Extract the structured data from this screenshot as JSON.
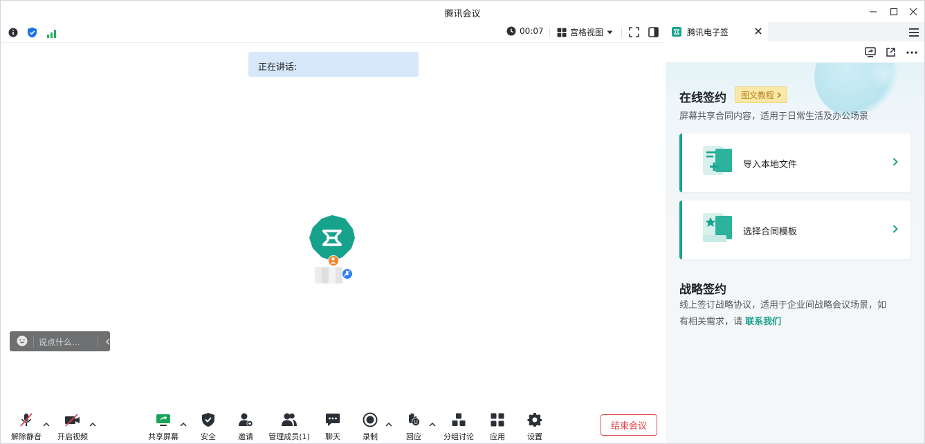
{
  "window": {
    "title": "腾讯会议"
  },
  "topbar": {
    "timer": "00:07",
    "view_label": "宫格视图"
  },
  "speaking": {
    "label": "正在讲话:"
  },
  "chat": {
    "placeholder": "说点什么..."
  },
  "toolbar": {
    "unmute": "解除静音",
    "start_video": "开启视频",
    "share_screen": "共享屏幕",
    "security": "安全",
    "invite": "邀请",
    "manage_members": "管理成员(1)",
    "chat": "聊天",
    "record": "录制",
    "react": "回应",
    "breakout": "分组讨论",
    "apps": "应用",
    "settings": "设置",
    "end_meeting": "结束会议"
  },
  "panel": {
    "tab_label": "腾讯电子签",
    "online": {
      "title": "在线签约",
      "tutorial": "图文教程",
      "desc": "屏幕共享合同内容，适用于日常生活及办公场景",
      "cards": [
        {
          "label": "导入本地文件"
        },
        {
          "label": "选择合同模板"
        }
      ]
    },
    "strategic": {
      "title": "战略签约",
      "desc_line1": "线上签订战略协议，适用于企业间战略会议场景，如",
      "desc_line2": "有相关需求，请",
      "contact_link": "联系我们"
    }
  },
  "colors": {
    "brand_teal": "#1aa38a",
    "end_red": "#e0464a",
    "speaking_bg": "#d7e8fb",
    "tag_yellow": "#fbe8a8"
  }
}
